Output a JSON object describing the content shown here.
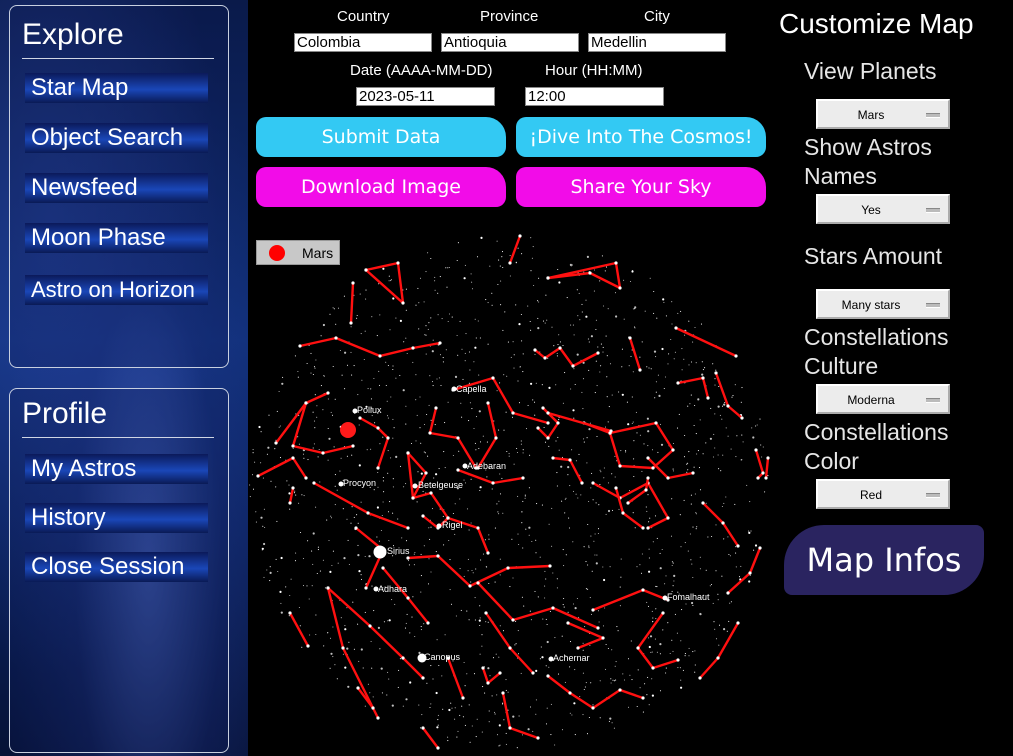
{
  "sidebar": {
    "explore_title": "Explore",
    "explore_items": [
      {
        "label": "Star Map"
      },
      {
        "label": "Object Search"
      },
      {
        "label": "Newsfeed"
      },
      {
        "label": "Moon Phase"
      },
      {
        "label": "Astro on Horizon"
      }
    ],
    "profile_title": "Profile",
    "profile_items": [
      {
        "label": "My Astros"
      },
      {
        "label": "History"
      },
      {
        "label": "Close Session"
      }
    ]
  },
  "form": {
    "country_label": "Country",
    "province_label": "Province",
    "city_label": "City",
    "country_value": "Colombia",
    "province_value": "Antioquia",
    "city_value": "Medellin",
    "date_label": "Date (AAAA-MM-DD)",
    "hour_label": "Hour (HH:MM)",
    "date_value": "2023-05-11",
    "hour_value": "12:00"
  },
  "actions": {
    "submit": "Submit Data",
    "dive": "¡Dive Into The Cosmos!",
    "download": "Download Image",
    "share": "Share Your Sky"
  },
  "legend": {
    "planet": "Mars",
    "planet_color": "#ff0000"
  },
  "sky": {
    "star_labels": [
      "Capella",
      "Pollux",
      "Adebaran",
      "Procyon",
      "Betelgeuse",
      "Rigel",
      "Sirius",
      "Adhara",
      "Fomalhaut",
      "Canopus",
      "Achernar"
    ],
    "constellation_color": "#ff1010"
  },
  "customize": {
    "title": "Customize Map",
    "view_planets_label": "View Planets",
    "view_planets_value": "Mars",
    "show_names_label_1": "Show Astros",
    "show_names_label_2": "Names",
    "show_names_value": "Yes",
    "stars_amount_label": "Stars Amount",
    "stars_amount_value": "Many stars",
    "culture_label_1": "Constellations",
    "culture_label_2": "Culture",
    "culture_value": "Moderna",
    "color_label_1": "Constellations",
    "color_label_2": "Color",
    "color_value": "Red",
    "map_infos": "Map Infos"
  }
}
